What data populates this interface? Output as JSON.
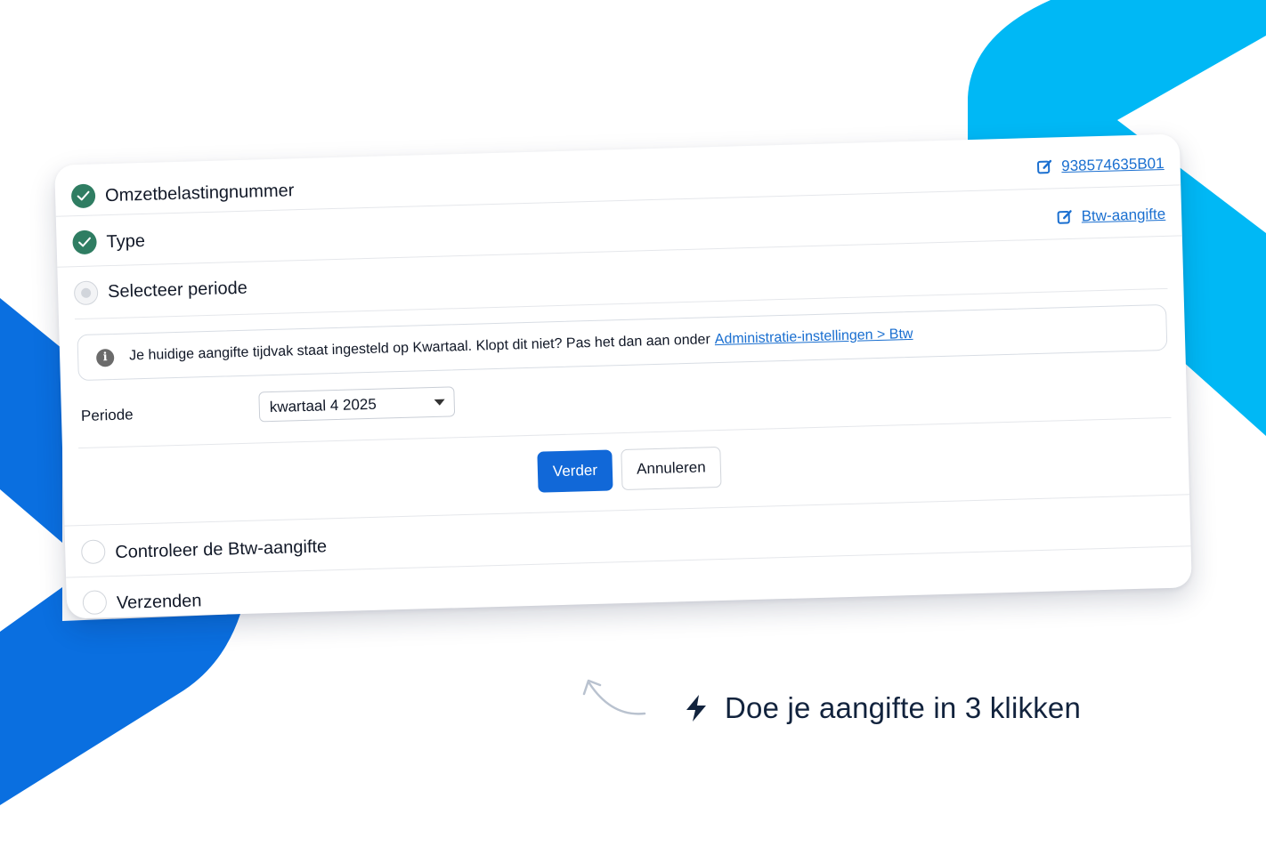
{
  "steps": {
    "vat_number": {
      "label": "Omzetbelastingnummer",
      "value": "938574635B01"
    },
    "type": {
      "label": "Type",
      "value": "Btw-aangifte"
    },
    "period": {
      "label": "Selecteer periode"
    },
    "review": {
      "label": "Controleer de Btw-aangifte"
    },
    "send": {
      "label": "Verzenden"
    }
  },
  "info_banner": {
    "text": "Je huidige aangifte tijdvak staat ingesteld op Kwartaal. Klopt dit niet? Pas het dan aan onder",
    "link": "Administratie-instellingen > Btw"
  },
  "period_field": {
    "label": "Periode",
    "selected": "kwartaal 4 2025"
  },
  "buttons": {
    "continue": "Verder",
    "cancel": "Annuleren"
  },
  "tagline": "Doe je aangifte in 3 klikken",
  "colors": {
    "accent_blue": "#1168d8",
    "link_blue": "#1a6fd0",
    "done_green": "#2f7d62",
    "bg_light_blue": "#00b8f5",
    "bg_dark_blue": "#0a6fe0",
    "tagline_navy": "#12233d"
  },
  "icons": [
    "check-icon",
    "edit-icon",
    "info-icon",
    "chevron-down-icon",
    "lightning-icon",
    "curved-arrow-icon"
  ]
}
